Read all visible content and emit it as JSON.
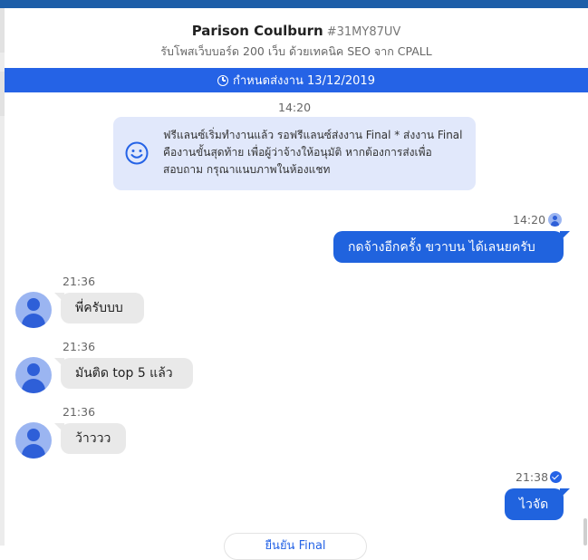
{
  "header": {
    "name": "Parison Coulburn",
    "code": "#31MY87UV",
    "subtitle": "รับโพสเว็บบอร์ด 200 เว็บ ด้วยเทคนิค SEO จาก CPALL"
  },
  "deadline": {
    "label": "กำหนดส่งงาน 13/12/2019"
  },
  "system_message": {
    "time": "14:20",
    "text": "ฟรีแลนซ์เริ่มทำงานแล้ว รอฟรีแลนซ์ส่งงาน Final * ส่งงาน Final คืองานขั้นสุดท้าย เพื่อผู้ว่าจ้างให้อนุมัติ หากต้องการส่งเพื่อสอบถาม กรุณาแนบภาพในห้องแชท"
  },
  "messages": [
    {
      "direction": "out",
      "time": "14:20",
      "text": "กดจ้างอีกครั้ง ขวาบน ได้เลนยครับ"
    },
    {
      "direction": "in",
      "time": "21:36",
      "text": "พี่ครับบบ"
    },
    {
      "direction": "in",
      "time": "21:36",
      "text": "มันติด top 5 แล้ว"
    },
    {
      "direction": "in",
      "time": "21:36",
      "text": "ว้าววว"
    },
    {
      "direction": "out",
      "time": "21:38",
      "text": "ไวจัด"
    }
  ],
  "bottom_button": {
    "label": "ยืนยัน Final"
  },
  "colors": {
    "accent": "#2563e6",
    "topbar": "#1d5ea8",
    "incoming_bubble": "#e9e9e9",
    "system_bg": "#e1e8fb"
  }
}
